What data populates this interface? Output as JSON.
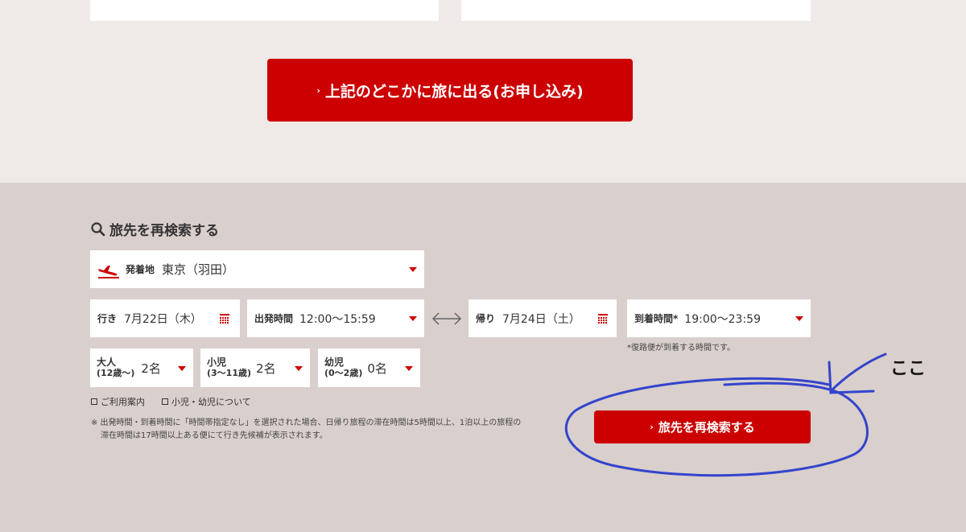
{
  "top_section": {
    "apply_button": "上記のどこかに旅に出る(お申し込み)"
  },
  "search": {
    "title": "旅先を再検索する",
    "departure": {
      "label": "発着地",
      "value": "東京（羽田）"
    },
    "outbound": {
      "label": "行き",
      "value": "7月22日（木）"
    },
    "departure_time": {
      "label": "出発時間",
      "value": "12:00〜15:59"
    },
    "return": {
      "label": "帰り",
      "value": "7月24日（土）"
    },
    "arrival_time": {
      "label": "到着時間*",
      "value": "19:00〜23:59"
    },
    "arrival_note": "*復路便が到着する時間です。",
    "adult": {
      "label": "大人",
      "sub": "(12歳〜)",
      "value": "2名"
    },
    "child": {
      "label": "小児",
      "sub": "(3〜11歳)",
      "value": "2名"
    },
    "infant": {
      "label": "幼児",
      "sub": "(0〜2歳)",
      "value": "0名"
    },
    "links": {
      "guide": "ご利用案内",
      "child_info": "小児・幼児について"
    },
    "notice_line1": "※ 出発時間・到着時間に「時間帯指定なし」を選択された場合、日帰り旅程の滞在時間は5時間以上、1泊以上の旅程の",
    "notice_line2": "滞在時間は17時間以上ある便にて行き先候補が表示されます。",
    "submit_button": "旅先を再検索する"
  },
  "annotation": {
    "text": "ここ"
  },
  "colors": {
    "accent": "#cc0000",
    "annotation": "#3344cc"
  }
}
